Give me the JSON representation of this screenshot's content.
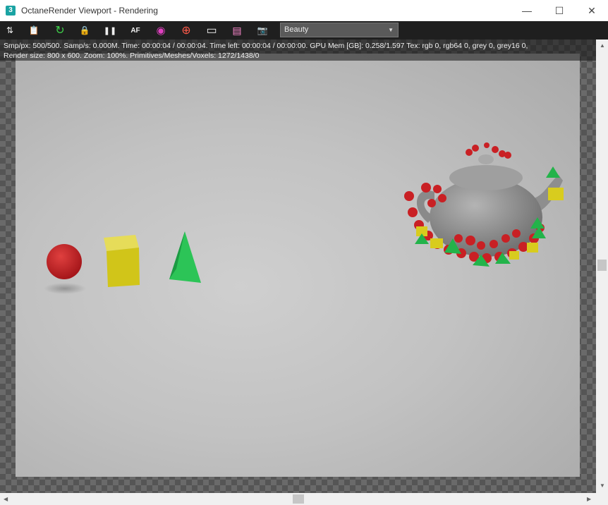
{
  "window": {
    "title": "OctaneRender Viewport - Rendering",
    "app_icon_glyph": "3",
    "controls": {
      "minimize": "—",
      "maximize": "☐",
      "close": "✕"
    }
  },
  "toolbar": {
    "buttons": [
      {
        "name": "send-to-max-icon",
        "glyph": "⇅"
      },
      {
        "name": "copy-to-clipboard-icon",
        "glyph": "📋"
      },
      {
        "name": "restart-render-icon",
        "glyph": "↻"
      },
      {
        "name": "lock-icon",
        "glyph": "🔒"
      },
      {
        "name": "pause-icon",
        "glyph": "❚❚"
      },
      {
        "name": "af-focus-icon",
        "glyph": "AF"
      },
      {
        "name": "color-picker-icon",
        "glyph": "◉"
      },
      {
        "name": "region-render-icon",
        "glyph": "⊕"
      },
      {
        "name": "display-icon",
        "glyph": "▭"
      },
      {
        "name": "film-icon",
        "glyph": "▤"
      },
      {
        "name": "camera-icon",
        "glyph": "📷"
      }
    ],
    "render_pass": "Beauty"
  },
  "status": {
    "line1": "Smp/px: 500/500.   Samp/s: 0.000M.   Time: 00:00:04 / 00:00:04.   Time left: 00:00:04 / 00:00:00.   GPU Mem [GB]: 0.258/1.597   Tex: rgb 0, rgb64 0, grey 0, grey16 0,",
    "line2": "Render size: 800 x 600.   Zoom: 100%.   Primitives/Meshes/Voxels: 1272/1438/0"
  },
  "colors": {
    "red": "#c21e22",
    "yellow": "#d8cc1e",
    "green": "#23b34a",
    "teapot": "#8e8e8e"
  }
}
